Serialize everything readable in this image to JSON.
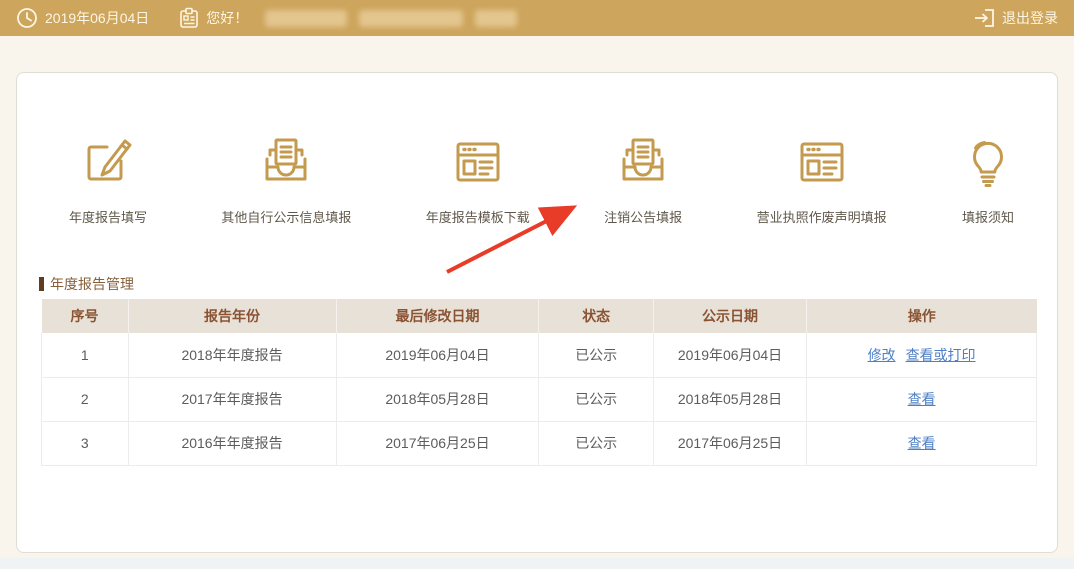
{
  "topbar": {
    "date": "2019年06月04日",
    "clock_icon": "clock-icon",
    "user_icon": "id-badge-icon",
    "greeting": "您好！",
    "user_name_redacted": "",
    "logout_icon": "logout-icon",
    "logout_label": "退出登录",
    "background_color": "#cda55c"
  },
  "shortcuts": [
    {
      "label": "年度报告填写",
      "icon": "edit-square-icon"
    },
    {
      "label": "其他自行公示信息填报",
      "icon": "submit-inbox-icon"
    },
    {
      "label": "年度报告模板下载",
      "icon": "template-window-icon"
    },
    {
      "label": "注销公告填报",
      "icon": "submit-inbox-icon"
    },
    {
      "label": "营业执照作废声明填报",
      "icon": "template-window-icon"
    },
    {
      "label": "填报须知",
      "icon": "lightbulb-icon"
    }
  ],
  "annotation": {
    "type": "red-arrow",
    "points_to": "注销公告填报",
    "color": "#e83b28"
  },
  "section": {
    "title": "年度报告管理"
  },
  "table": {
    "headers": [
      "序号",
      "报告年份",
      "最后修改日期",
      "状态",
      "公示日期",
      "操作"
    ],
    "rows": [
      {
        "no": "1",
        "year": "2018年年度报告",
        "modified": "2019年06月04日",
        "status": "已公示",
        "published": "2019年06月04日",
        "actions": [
          {
            "label": "修改"
          },
          {
            "label": "查看或打印"
          }
        ]
      },
      {
        "no": "2",
        "year": "2017年年度报告",
        "modified": "2018年05月28日",
        "status": "已公示",
        "published": "2018年05月28日",
        "actions": [
          {
            "label": "查看"
          }
        ]
      },
      {
        "no": "3",
        "year": "2016年年度报告",
        "modified": "2017年06月25日",
        "status": "已公示",
        "published": "2017年06月25日",
        "actions": [
          {
            "label": "查看"
          }
        ]
      }
    ]
  },
  "colors": {
    "topbar_gold": "#cda55c",
    "page_cream": "#f9f5ec",
    "icon_gold": "#c49a4f",
    "header_bg": "#e8e1d7",
    "header_text": "#8a5434",
    "link_blue": "#4d7fc6",
    "arrow_red": "#e83b28"
  }
}
